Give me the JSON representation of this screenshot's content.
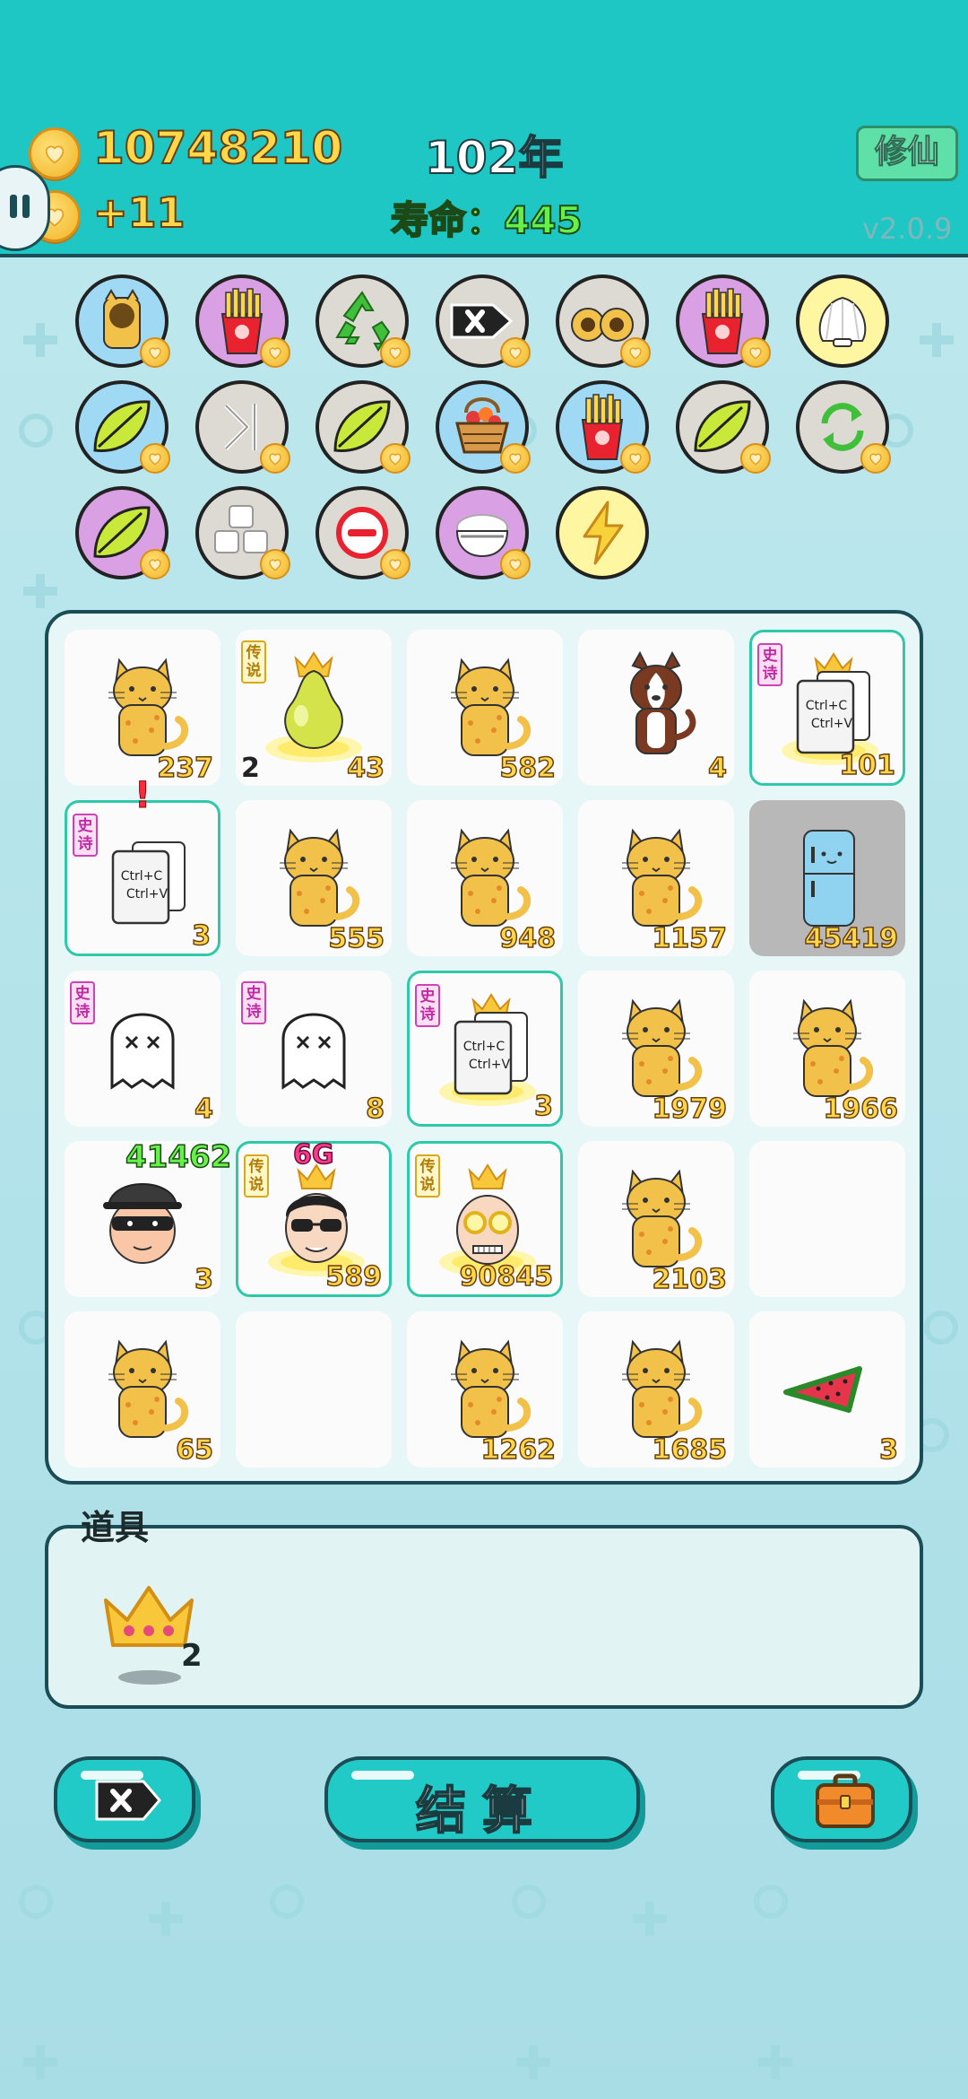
{
  "header": {
    "coins": "10748210",
    "coin_rate": "+11",
    "year": "102年",
    "lifespan": "寿命：445",
    "cultivate_button": "修仙",
    "version": "v2.0.9"
  },
  "abilities": [
    {
      "icon": "cat-icon",
      "color": "blue"
    },
    {
      "icon": "fries-icon",
      "color": "purple"
    },
    {
      "icon": "recycle-icon",
      "color": "gray"
    },
    {
      "icon": "delete-tag-icon",
      "color": "gray"
    },
    {
      "icon": "twin-cats-icon",
      "color": "gray"
    },
    {
      "icon": "fries-icon",
      "color": "purple"
    },
    {
      "icon": "shell-icon",
      "color": "yellow"
    },
    {
      "icon": "leaf-icon",
      "color": "blue"
    },
    {
      "icon": "skip-icon",
      "color": "gray"
    },
    {
      "icon": "leaf-icon",
      "color": "gray"
    },
    {
      "icon": "fruit-basket-icon",
      "color": "blue"
    },
    {
      "icon": "fries-icon",
      "color": "blue"
    },
    {
      "icon": "leaf-icon",
      "color": "gray"
    },
    {
      "icon": "refresh-icon",
      "color": "gray"
    },
    {
      "icon": "leaf-icon",
      "color": "purple"
    },
    {
      "icon": "sugar-cubes-icon",
      "color": "gray"
    },
    {
      "icon": "minus-icon",
      "color": "gray"
    },
    {
      "icon": "rice-bowl-icon",
      "color": "purple"
    },
    {
      "icon": "lightning-icon",
      "color": "yellow"
    }
  ],
  "board": [
    {
      "item": "cat",
      "count": "237"
    },
    {
      "item": "pear",
      "count": "43",
      "tag": "传说",
      "left_count": "2"
    },
    {
      "item": "cat",
      "count": "582"
    },
    {
      "item": "husky",
      "count": "4"
    },
    {
      "item": "copy-paste",
      "count": "101",
      "tag": "史诗",
      "crown": true
    },
    {
      "item": "copy-paste",
      "count": "3",
      "tag": "史诗",
      "alert": "!"
    },
    {
      "item": "cat",
      "count": "555"
    },
    {
      "item": "cat",
      "count": "948"
    },
    {
      "item": "cat",
      "count": "1157"
    },
    {
      "item": "fridge",
      "count": "45419"
    },
    {
      "item": "ghost",
      "count": "4",
      "tag": "史诗"
    },
    {
      "item": "ghost",
      "count": "8",
      "tag": "史诗"
    },
    {
      "item": "copy-paste",
      "count": "3",
      "tag": "史诗",
      "crown": true
    },
    {
      "item": "cat",
      "count": "1979"
    },
    {
      "item": "cat",
      "count": "1966"
    },
    {
      "item": "thief",
      "count": "3",
      "above": "41462"
    },
    {
      "item": "sunglasses-man",
      "count": "589",
      "tag": "传说",
      "above": "6G"
    },
    {
      "item": "old-man",
      "count": "90845",
      "tag": "传说"
    },
    {
      "item": "cat",
      "count": "2103"
    },
    {
      "item": "empty",
      "count": ""
    },
    {
      "item": "cat",
      "count": "65"
    },
    {
      "item": "empty",
      "count": ""
    },
    {
      "item": "cat",
      "count": "1262"
    },
    {
      "item": "cat",
      "count": "1685"
    },
    {
      "item": "watermelon",
      "count": "3"
    }
  ],
  "items_panel": {
    "title": "道具",
    "crown_count": "2"
  },
  "buttons": {
    "settle_label": "结算",
    "delete_icon": "delete-tag-icon",
    "bag_icon": "briefcase-icon"
  },
  "colors": {
    "header_bg": "#1ec6c4",
    "button_bg": "#21cac6",
    "count_yellow": "#ffd84a",
    "outline": "#1a4d55"
  }
}
